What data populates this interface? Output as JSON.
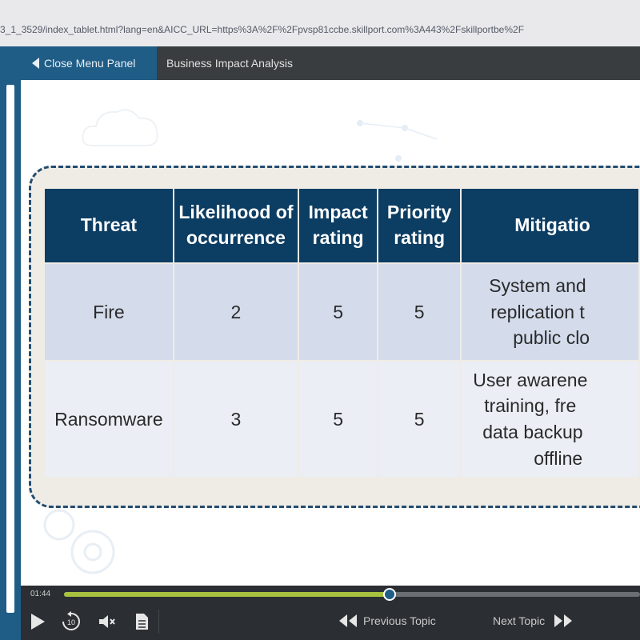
{
  "browser": {
    "url": "3_1_3529/index_tablet.html?lang=en&AICC_URL=https%3A%2F%2Fpvsp81ccbe.skillport.com%3A443%2Fskillportbe%2F"
  },
  "topnav": {
    "close_menu_label": "Close Menu Panel",
    "course_title": "Business Impact Analysis"
  },
  "table": {
    "headers": [
      "Threat",
      "Likelihood of occurrence",
      "Impact rating",
      "Priority rating",
      "Mitigatio"
    ],
    "rows": [
      {
        "threat": "Fire",
        "likelihood": "2",
        "impact": "5",
        "priority": "5",
        "mitigation": [
          "System and",
          "replication t",
          "public clo"
        ]
      },
      {
        "threat": "Ransomware",
        "likelihood": "3",
        "impact": "5",
        "priority": "5",
        "mitigation": [
          "User awarene",
          "training, fre",
          "data backup",
          "offline"
        ]
      }
    ]
  },
  "player": {
    "time": "01:44",
    "progress_percent": 56.5,
    "prev_label": "Previous Topic",
    "next_label": "Next Topic",
    "colors": {
      "progress": "#a8c23f",
      "handle": "#1f5d86",
      "header": "#0c3d63",
      "accent": "#1f5d86"
    }
  },
  "icons": [
    "play-icon",
    "replay-10-icon",
    "volume-icon",
    "transcript-icon",
    "previous-topic-icon",
    "next-topic-icon",
    "chevron-left-icon"
  ]
}
